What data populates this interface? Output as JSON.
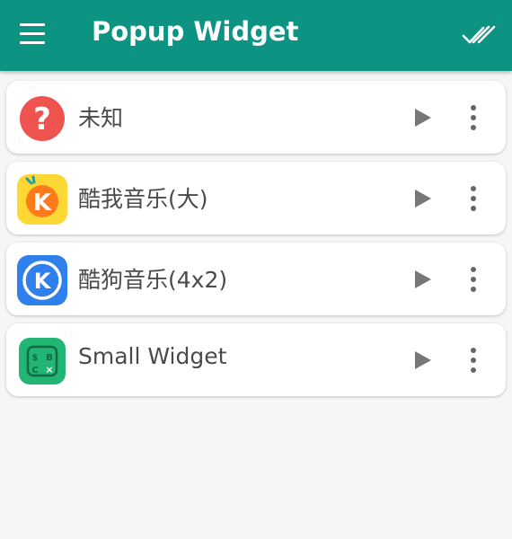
{
  "appbar": {
    "title": "Popup Widget",
    "menu_icon": "hamburger-menu-icon",
    "action_icon": "double-check-icon",
    "color": "#0c9382"
  },
  "widgets": [
    {
      "label": "未知",
      "icon": "question-mark-icon",
      "icon_color": "#ef5350"
    },
    {
      "label": "酷我音乐(大)",
      "icon": "kuwo-music-app-icon",
      "icon_color": "#fdd835"
    },
    {
      "label": "酷狗音乐(4x2)",
      "icon": "kugou-music-app-icon",
      "icon_color": "#2f80ed"
    },
    {
      "label": "Small Widget",
      "icon": "small-widget-app-icon",
      "icon_color": "#22b573"
    }
  ],
  "row_actions": {
    "play_icon": "play-icon",
    "more_icon": "more-vert-icon"
  }
}
